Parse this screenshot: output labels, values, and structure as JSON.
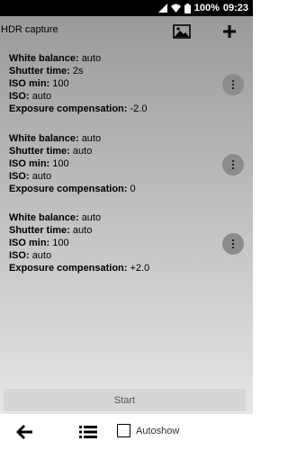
{
  "status_bar": {
    "battery": "100%",
    "time": "09:23"
  },
  "toolbar": {
    "title": "HDR capture",
    "gallery_icon": "image-icon",
    "add_icon": "plus-icon"
  },
  "configs": [
    {
      "white_balance_label": "White balance:",
      "white_balance_value": "auto",
      "shutter_label": "Shutter time:",
      "shutter_value": "2s",
      "iso_min_label": "ISO min:",
      "iso_min_value": "100",
      "iso_label": "ISO:",
      "iso_value": "auto",
      "exposure_label": "Exposure compensation:",
      "exposure_value": "-2.0"
    },
    {
      "white_balance_label": "White balance:",
      "white_balance_value": "auto",
      "shutter_label": "Shutter time:",
      "shutter_value": "auto",
      "iso_min_label": "ISO min:",
      "iso_min_value": "100",
      "iso_label": "ISO:",
      "iso_value": "auto",
      "exposure_label": "Exposure compensation:",
      "exposure_value": "0"
    },
    {
      "white_balance_label": "White balance:",
      "white_balance_value": "auto",
      "shutter_label": "Shutter time:",
      "shutter_value": "auto",
      "iso_min_label": "ISO min:",
      "iso_min_value": "100",
      "iso_label": "ISO:",
      "iso_value": "auto",
      "exposure_label": "Exposure compensation:",
      "exposure_value": "+2.0"
    }
  ],
  "start_label": "Start",
  "bottom_bar": {
    "back_icon": "arrow-left-icon",
    "list_icon": "list-icon",
    "autoshow_label": "Autoshow",
    "autoshow_checked": false
  },
  "colors": {
    "menu_button": "#8c8c8c",
    "start_button": "#d6d6d6"
  }
}
